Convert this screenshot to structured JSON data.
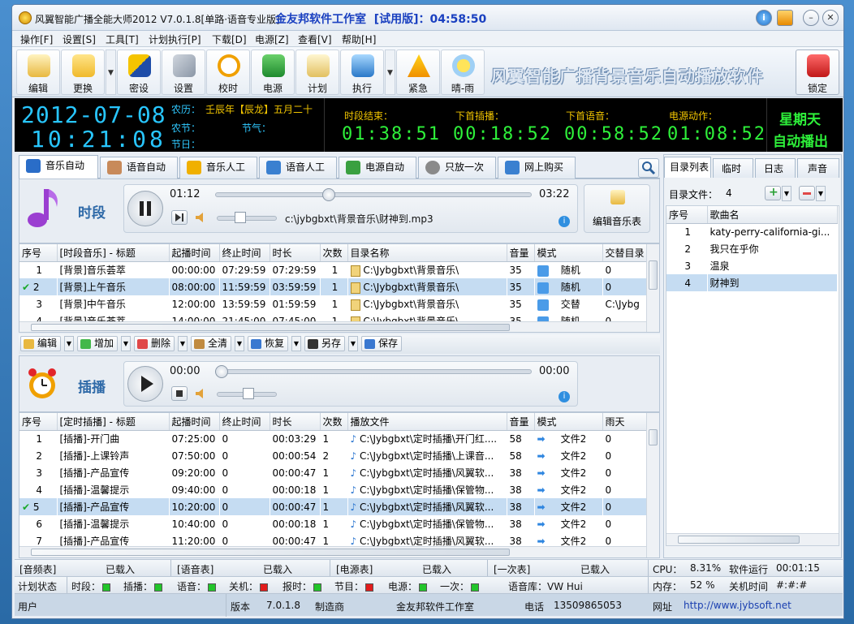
{
  "title": {
    "app": "风翼智能广播全能大师2012 V7.0.1.8[单路·语音专业版]",
    "brand": "金友邦软件工作室",
    "trial": "[试用版]：04:58:50"
  },
  "menu": [
    "操作[F]",
    "设置[S]",
    "工具[T]",
    "计划执行[P]",
    "下载[D]",
    "电源[Z]",
    "查看[V]",
    "帮助[H]"
  ],
  "toolbar": {
    "buttons": [
      "编辑",
      "更换",
      "密设",
      "设置",
      "校时",
      "电源",
      "计划",
      "执行",
      "紧急",
      "晴-雨",
      "锁定"
    ],
    "slogan": "风翼智能广播背景音乐自动播放软件"
  },
  "lcd": {
    "date": "2012-07-08",
    "time": "10:21:08",
    "lunar_label": "农历：",
    "lunar_value": "壬辰年【辰龙】五月二十",
    "festival_label": "农节：",
    "solar_term_label": "节气：",
    "holiday_label": "节日：",
    "segment_end_label": "时段结束：",
    "segment_end": "01:38:51",
    "next_insert_label": "下首插播：",
    "next_insert": "00:18:52",
    "next_voice_label": "下首语音：",
    "next_voice": "00:58:52",
    "power_label": "电源动作：",
    "power": "01:08:52",
    "weekday": "星期天",
    "auto_play": "自动播出"
  },
  "tabs": [
    "音乐自动",
    "语音自动",
    "音乐人工",
    "语音人工",
    "电源自动",
    "只放一次",
    "网上购买"
  ],
  "segment": {
    "title": "时段",
    "pos": "01:12",
    "total": "03:22",
    "position_fraction": 0.36,
    "file": "c:\\jybgbxt\\背景音乐\\财神到.mp3",
    "edit_label": "编辑音乐表",
    "columns": [
      "序号",
      "[时段音乐] - 标题",
      "起播时间",
      "终止时间",
      "时长",
      "次数",
      "目录名称",
      "音量",
      "模式",
      "交替目录"
    ],
    "rows": [
      [
        "1",
        "[背景]音乐荟萃",
        "00:00:00",
        "07:29:59",
        "07:29:59",
        "1",
        "C:\\Jybgbxt\\背景音乐\\",
        "35",
        "随机",
        "0"
      ],
      [
        "2",
        "[背景]上午音乐",
        "08:00:00",
        "11:59:59",
        "03:59:59",
        "1",
        "C:\\Jybgbxt\\背景音乐\\",
        "35",
        "随机",
        "0"
      ],
      [
        "3",
        "[背景]中午音乐",
        "12:00:00",
        "13:59:59",
        "01:59:59",
        "1",
        "C:\\Jybgbxt\\背景音乐\\",
        "35",
        "交替",
        "C:\\Jybg"
      ],
      [
        "4",
        "[背景]音乐荟萃",
        "14:00:00",
        "21:45:00",
        "07:45:00",
        "1",
        "C:\\Jybgbxt\\背景音乐\\",
        "35",
        "随机",
        "0"
      ]
    ]
  },
  "editbar": [
    "编辑",
    "增加",
    "删除",
    "全清",
    "恢复",
    "另存",
    "保存"
  ],
  "insert": {
    "title": "插播",
    "pos": "00:00",
    "total": "00:00",
    "position_fraction": 0,
    "columns": [
      "序号",
      "[定时插播] - 标题",
      "起播时间",
      "终止时间",
      "时长",
      "次数",
      "播放文件",
      "音量",
      "模式",
      "雨天"
    ],
    "rows": [
      [
        "1",
        "[插播]-开门曲",
        "07:25:00",
        "0",
        "00:03:29",
        "1",
        "C:\\Jybgbxt\\定时插播\\开门红....",
        "58",
        "文件2",
        "0"
      ],
      [
        "2",
        "[插播]-上课铃声",
        "07:50:00",
        "0",
        "00:00:54",
        "2",
        "C:\\Jybgbxt\\定时插播\\上课音...",
        "58",
        "文件2",
        "0"
      ],
      [
        "3",
        "[插播]-产品宣传",
        "09:20:00",
        "0",
        "00:00:47",
        "1",
        "C:\\Jybgbxt\\定时插播\\风翼软...",
        "38",
        "文件2",
        "0"
      ],
      [
        "4",
        "[插播]-温馨提示",
        "09:40:00",
        "0",
        "00:00:18",
        "1",
        "C:\\Jybgbxt\\定时插播\\保管物...",
        "38",
        "文件2",
        "0"
      ],
      [
        "5",
        "[插播]-产品宣传",
        "10:20:00",
        "0",
        "00:00:47",
        "1",
        "C:\\Jybgbxt\\定时插播\\风翼软...",
        "38",
        "文件2",
        "0"
      ],
      [
        "6",
        "[插播]-温馨提示",
        "10:40:00",
        "0",
        "00:00:18",
        "1",
        "C:\\Jybgbxt\\定时插播\\保管物...",
        "38",
        "文件2",
        "0"
      ],
      [
        "7",
        "[插播]-产品宣传",
        "11:20:00",
        "0",
        "00:00:47",
        "1",
        "C:\\Jybgbxt\\定时插播\\风翼软...",
        "38",
        "文件2",
        "0"
      ]
    ]
  },
  "right": {
    "tabs": [
      "目录列表",
      "临时",
      "日志",
      "声音"
    ],
    "file_count_label": "目录文件：",
    "file_count": "4",
    "columns": [
      "序号",
      "歌曲名"
    ],
    "rows": [
      [
        "1",
        "katy-perry-california-gi..."
      ],
      [
        "2",
        "我只在乎你"
      ],
      [
        "3",
        "温泉"
      ],
      [
        "4",
        "财神到"
      ]
    ]
  },
  "status": {
    "row1": [
      "[音频表]",
      "已载入",
      "[语音表]",
      "已载入",
      "[电源表]",
      "已载入",
      "[一次表]",
      "已载入",
      "CPU：",
      "8.31%",
      "软件运行",
      "00:01:15"
    ],
    "row2": {
      "plan": "计划状态",
      "items": [
        "时段：",
        "插播：",
        "语音：",
        "关机：",
        "报时：",
        "节目：",
        "电源：",
        "一次："
      ],
      "colors": [
        "#22c52a",
        "#22c52a",
        "#22c52a",
        "#e21c1c",
        "#22c52a",
        "#e21c1c",
        "#22c52a",
        "#22c52a"
      ],
      "voice_lib": "语音库：VW Hui",
      "mem_label": "内存：",
      "mem": "52 %",
      "shutdown_label": "关机时间",
      "shutdown": "#:#:#"
    },
    "row3": [
      "用户",
      "版本",
      "7.0.1.8",
      "制造商",
      "金友邦软件工作室",
      "电话",
      "13509865053",
      "网址",
      "http://www.jybsoft.net"
    ]
  }
}
